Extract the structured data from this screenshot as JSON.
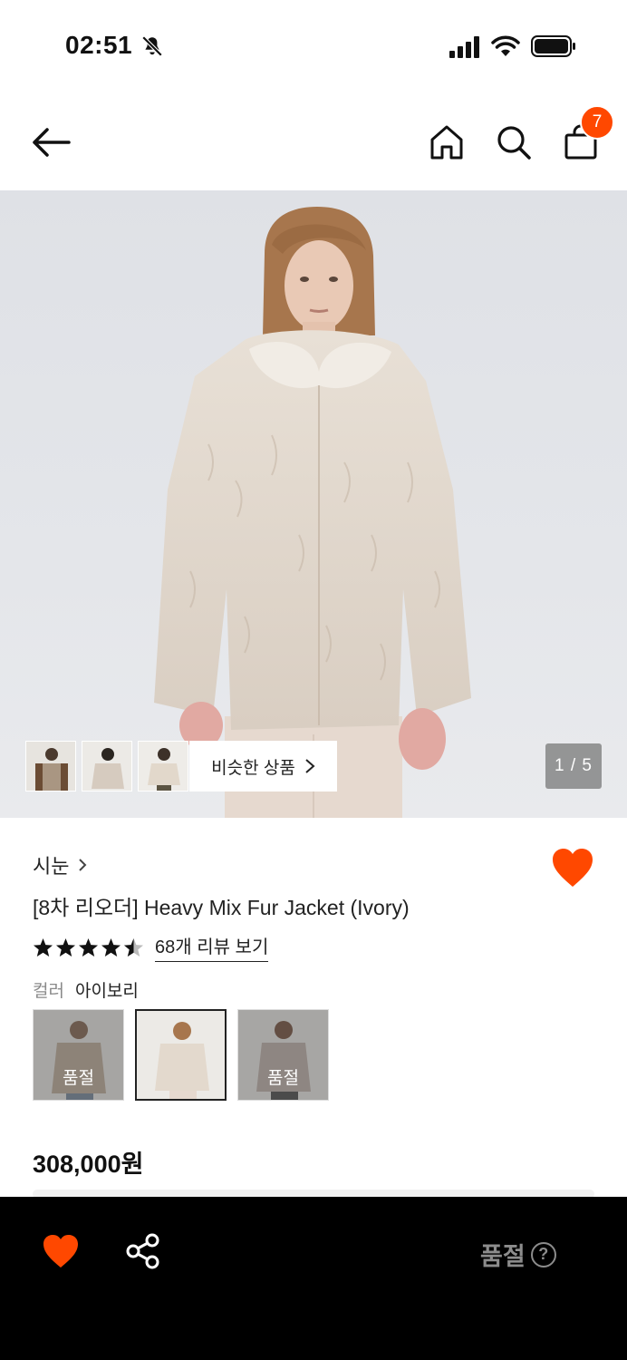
{
  "status_bar": {
    "time": "02:51",
    "icons": [
      "bell-slash-icon",
      "cellular-signal-icon",
      "wifi-icon",
      "battery-icon"
    ]
  },
  "nav": {
    "icons": [
      "back-arrow-icon",
      "home-icon",
      "search-icon",
      "shopping-bag-icon"
    ],
    "cart_count": "7"
  },
  "gallery": {
    "thumbnail_count": 3,
    "similar_button_label": "비슷한 상품",
    "page_indicator": "1 / 5"
  },
  "product": {
    "brand": "시눈",
    "title": "[8차 리오더] Heavy Mix Fur Jacket (Ivory)",
    "rating": 4.5,
    "review_link": "68개 리뷰 보기",
    "color_label": "컬러",
    "color_value": "아이보리",
    "swatches": [
      {
        "selected": false,
        "badge": "품절"
      },
      {
        "selected": true,
        "badge": ""
      },
      {
        "selected": false,
        "badge": "품절"
      }
    ],
    "price": "308,000원",
    "wishlisted": true
  },
  "bottom_bar": {
    "status_label": "품절",
    "help_symbol": "?",
    "icons": [
      "heart-icon",
      "share-icon",
      "help-circle-icon"
    ]
  },
  "colors": {
    "accent": "#ff4800",
    "bottom_bar_bg": "#000000",
    "soldout_text": "#8c8c8c"
  }
}
